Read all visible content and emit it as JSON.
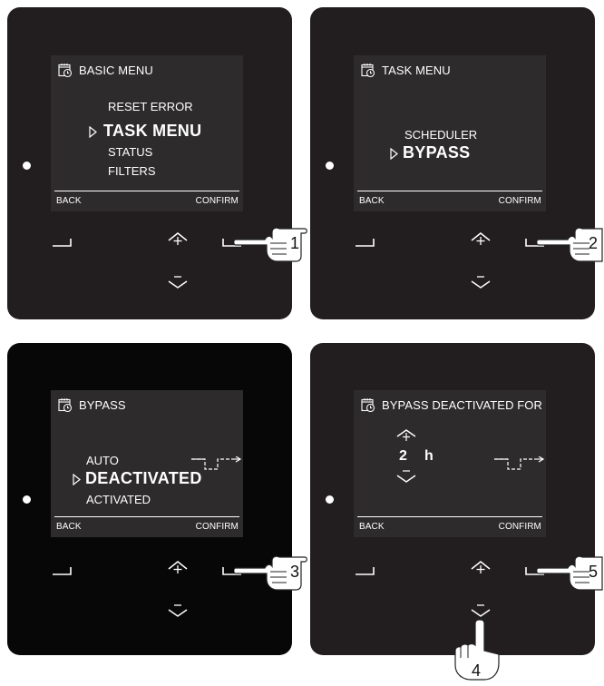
{
  "panel1": {
    "header": "BASIC MENU",
    "items": [
      "RESET ERROR",
      "TASK MENU",
      "STATUS",
      "FILTERS"
    ],
    "selected_index": 1,
    "softkey_left": "BACK",
    "softkey_right": "CONFIRM",
    "step": "1"
  },
  "panel2": {
    "header": "TASK MENU",
    "items": [
      "SCHEDULER",
      "BYPASS"
    ],
    "selected_index": 1,
    "softkey_left": "BACK",
    "softkey_right": "CONFIRM",
    "step": "2"
  },
  "panel3": {
    "header": "BYPASS",
    "items": [
      "AUTO",
      "DEACTIVATED",
      "ACTIVATED"
    ],
    "selected_index": 1,
    "softkey_left": "BACK",
    "softkey_right": "CONFIRM",
    "step": "3",
    "symbol": "bypass-valve-symbol"
  },
  "panel4": {
    "header": "BYPASS DEACTIVATED FOR",
    "value": "2",
    "unit": "h",
    "softkey_left": "BACK",
    "softkey_right": "CONFIRM",
    "step_confirm": "5",
    "step_down": "4",
    "symbol": "bypass-valve-symbol"
  },
  "colors": {
    "panel": "#221e1f",
    "panel_black": "#070707",
    "screen": "#2e2b2c",
    "text": "#ffffff"
  }
}
